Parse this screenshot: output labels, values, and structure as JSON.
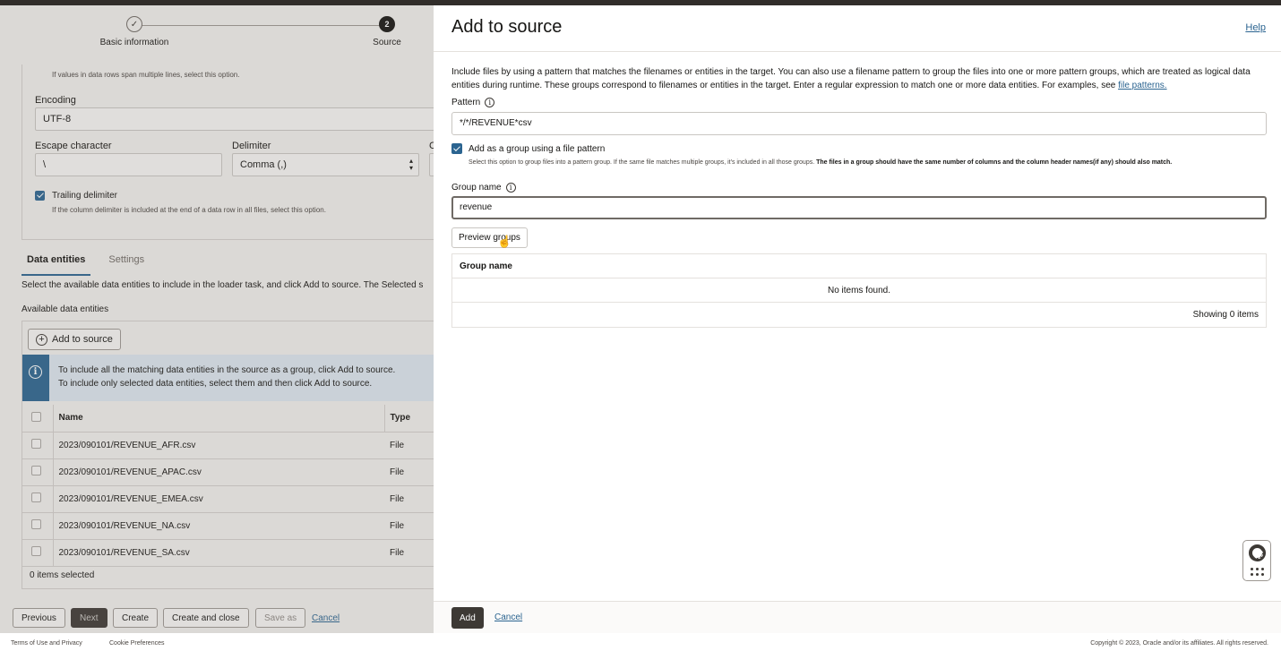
{
  "wizard": {
    "steps": [
      {
        "label": "Basic information",
        "marker": "✓",
        "state": "done"
      },
      {
        "label": "Source",
        "marker": "2",
        "state": "current"
      }
    ]
  },
  "form": {
    "multiline_hint": "If values in data rows span multiple lines, select this option.",
    "encoding_label": "Encoding",
    "encoding_value": "UTF-8",
    "escape_label": "Escape character",
    "escape_value": "\\",
    "delimiter_label": "Delimiter",
    "delimiter_value": "Comma (,)",
    "truncated_label": "C",
    "trailing_label": "Trailing delimiter",
    "trailing_hint": "If the column delimiter is included at the end of a data row in all files, select this option."
  },
  "tabs": [
    {
      "label": "Data entities",
      "active": true
    },
    {
      "label": "Settings",
      "active": false
    }
  ],
  "entities": {
    "intro": "Select the available data entities to include in the loader task, and click Add to source. The Selected s",
    "available_label": "Available data entities",
    "add_button": "Add to source",
    "info_line1": "To include all the matching data entities in the source as a group, click Add to source.",
    "info_line2": "To include only selected data entities, select them and then click Add to source.",
    "columns": [
      "Name",
      "Type"
    ],
    "rows": [
      {
        "name": "2023/090101/REVENUE_AFR.csv",
        "type": "File"
      },
      {
        "name": "2023/090101/REVENUE_APAC.csv",
        "type": "File"
      },
      {
        "name": "2023/090101/REVENUE_EMEA.csv",
        "type": "File"
      },
      {
        "name": "2023/090101/REVENUE_NA.csv",
        "type": "File"
      },
      {
        "name": "2023/090101/REVENUE_SA.csv",
        "type": "File"
      }
    ],
    "selected_count": "0 items selected"
  },
  "footer": {
    "previous": "Previous",
    "next": "Next",
    "create": "Create",
    "create_close": "Create and close",
    "save_as": "Save as",
    "cancel": "Cancel"
  },
  "bottom": {
    "terms": "Terms of Use and Privacy",
    "cookies": "Cookie Preferences",
    "copyright": "Copyright © 2023, Oracle and/or its affiliates. All rights reserved."
  },
  "panel": {
    "title": "Add to source",
    "help": "Help",
    "description": "Include files by using a pattern that matches the filenames or entities in the target. You can also use a filename pattern to group the files into one or more pattern groups, which are treated as logical data entities during runtime. These groups correspond to filenames or entities in the target. Enter a regular expression to match one or more data entities. For examples, see",
    "description_link": "file patterns.",
    "pattern_label": "Pattern",
    "pattern_value": "*/*/REVENUE*csv",
    "group_checkbox_label": "Add as a group using a file pattern",
    "group_hint": "Select this option to group files into a pattern group. If the same file matches multiple groups, it's included in all those groups.",
    "group_hint_bold": "The files in a group should have the same number of columns and the column header names(if any) should also match.",
    "group_name_label": "Group name",
    "group_name_value": "revenue",
    "preview_button": "Preview groups",
    "table_header": "Group name",
    "no_items": "No items found.",
    "showing": "Showing 0 items",
    "add": "Add",
    "cancel": "Cancel"
  },
  "icons": {
    "info": "info-icon",
    "help_widget": "lifebuoy-icon",
    "apps": "grid-icon",
    "pointer": "hand-pointer-icon"
  },
  "colors": {
    "accent": "#2b6490",
    "dark_button": "#3d3935",
    "topbar": "#312d2a"
  }
}
